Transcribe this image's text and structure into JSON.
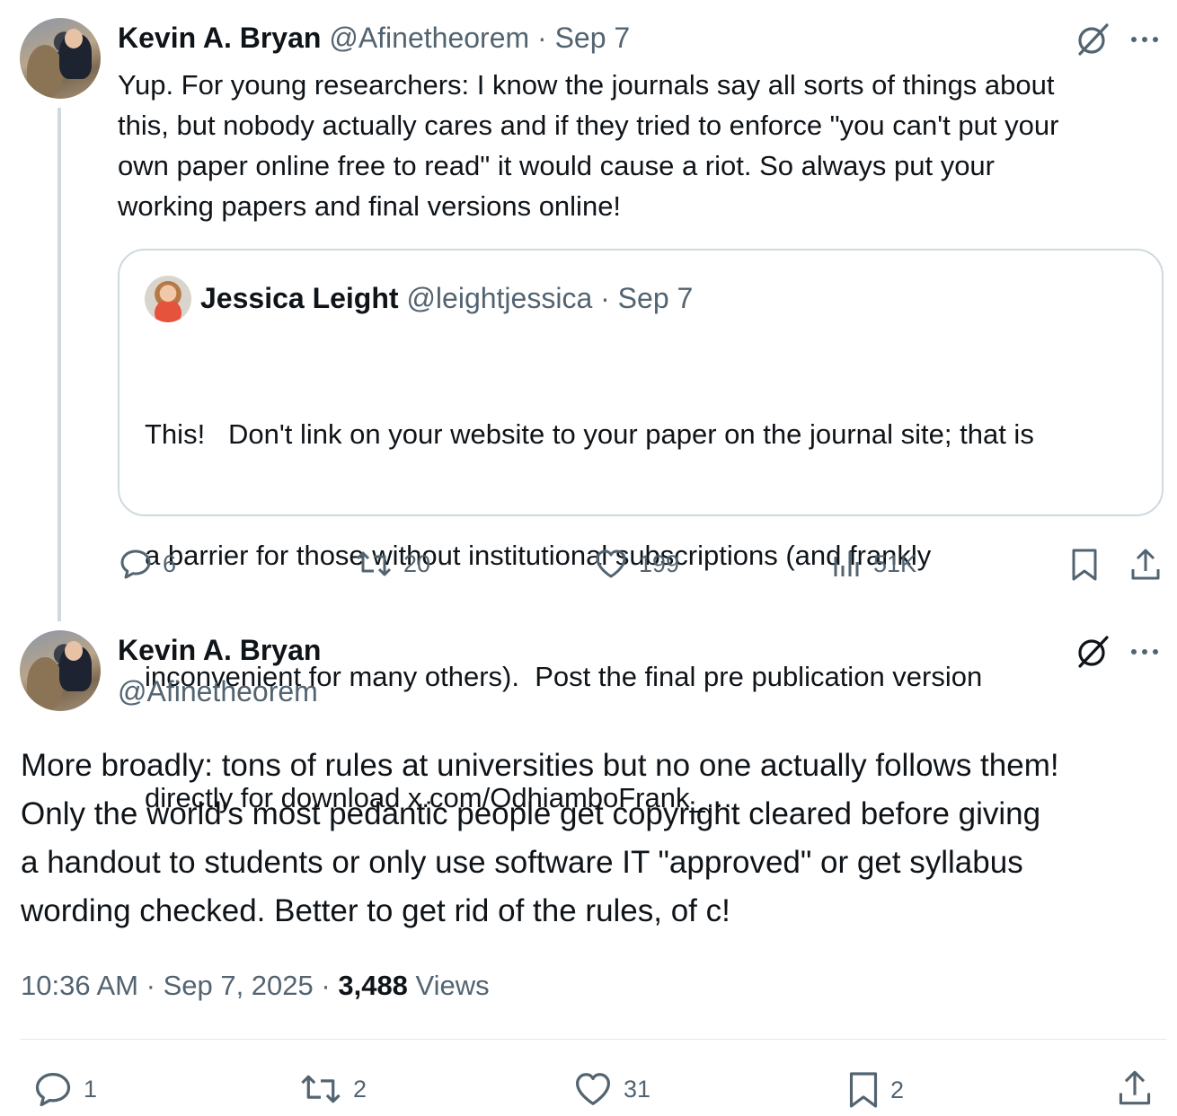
{
  "tweet1": {
    "author": "Kevin A. Bryan",
    "handle": "@Afinetheorem",
    "sep": "·",
    "date": "Sep 7",
    "text_lines": [
      "Yup. For young researchers: I know the journals say all sorts of things about",
      "this, but nobody actually cares and if they tried to enforce \"you can't put your",
      "own paper online free to read\" it would cause a riot. So always put your",
      "working papers and final versions online!"
    ],
    "quote": {
      "author": "Jessica Leight",
      "handle": "@leightjessica",
      "sep": "·",
      "date": "Sep 7",
      "text_lines": [
        "This!   Don't link on your website to your paper on the journal site; that is",
        "a barrier for those without institutional subscriptions (and frankly",
        "inconvenient for many others).  Post the final pre publication version",
        "directly for download x.com/OdhiamboFrank_…"
      ]
    },
    "stats": {
      "replies": "6",
      "reposts": "20",
      "likes": "199",
      "views": "51K"
    }
  },
  "tweet2": {
    "author": "Kevin A. Bryan",
    "handle": "@Afinetheorem",
    "text_lines": [
      "More broadly: tons of rules at universities but no one actually follows them!",
      "Only the world's most pedantic people get copyright cleared before giving",
      "a handout to students or only use software IT \"approved\" or get syllabus",
      "wording checked. Better to get rid of the rules, of c!"
    ],
    "meta": {
      "time": "10:36 AM",
      "sep1": "·",
      "date": "Sep 7, 2025",
      "sep2": "·",
      "views_count": "3,488",
      "views_label": "Views"
    },
    "stats": {
      "replies": "1",
      "reposts": "2",
      "likes": "31",
      "bookmarks": "2"
    }
  },
  "icons": {
    "grok": "grok-slash-icon",
    "more": "more-dots-icon",
    "reply": "reply-bubble-icon",
    "repost": "repost-arrows-icon",
    "like": "heart-icon",
    "views": "bar-chart-icon",
    "bookmark": "bookmark-icon",
    "share": "share-upload-icon"
  },
  "colors": {
    "text": "#0f1419",
    "muted": "#536471",
    "border": "#cfd9de"
  }
}
